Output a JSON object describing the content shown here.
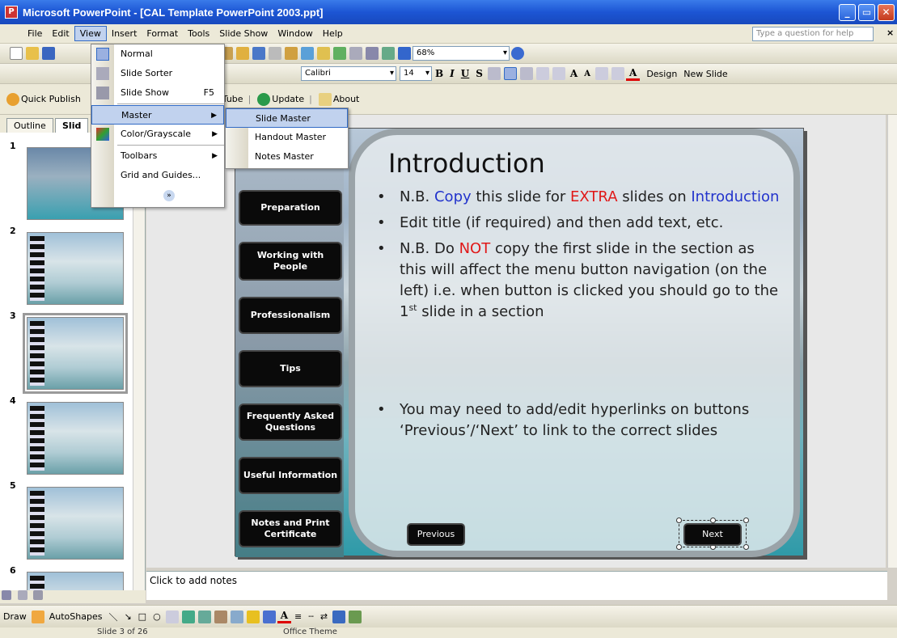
{
  "window": {
    "title": "Microsoft PowerPoint - [CAL Template PowerPoint 2003.ppt]"
  },
  "menubar": {
    "items": [
      "File",
      "Edit",
      "View",
      "Insert",
      "Format",
      "Tools",
      "Slide Show",
      "Window",
      "Help"
    ],
    "help_placeholder": "Type a question for help"
  },
  "toolbar": {
    "zoom": "68%",
    "font": "Calibri",
    "font_size": "14",
    "design": "Design",
    "new_slide": "New Slide",
    "quick_publish": "Quick Publish",
    "youtube": "uTube",
    "update": "Update",
    "about": "About"
  },
  "tabs": {
    "outline": "Outline",
    "slides": "Slid"
  },
  "thumbnails": [
    "1",
    "2",
    "3",
    "4",
    "5",
    "6"
  ],
  "view_menu": {
    "items": [
      {
        "label": "Normal",
        "shortcut": ""
      },
      {
        "label": "Slide Sorter",
        "shortcut": ""
      },
      {
        "label": "Slide Show",
        "shortcut": "F5"
      },
      {
        "label": "Master",
        "shortcut": ""
      },
      {
        "label": "Color/Grayscale",
        "shortcut": ""
      },
      {
        "label": "Toolbars",
        "shortcut": ""
      },
      {
        "label": "Grid and Guides...",
        "shortcut": ""
      }
    ]
  },
  "master_menu": {
    "items": [
      "Slide Master",
      "Handout Master",
      "Notes Master"
    ]
  },
  "slide": {
    "title": "Introduction",
    "nav_buttons": [
      "Preparation",
      "Working with People",
      "Professionalism",
      "Tips",
      "Frequently Asked Questions",
      "Useful Information",
      "Notes and Print Certificate"
    ],
    "bullet1_a": "N.B. ",
    "bullet1_b": "Copy",
    "bullet1_c": " this slide for ",
    "bullet1_d": "EXTRA",
    "bullet1_e": " slides on ",
    "bullet1_f": "Introduction",
    "bullet2": "Edit title (if required) and then add text, etc.",
    "bullet3_a": "N.B. Do ",
    "bullet3_b": "NOT",
    "bullet3_c": " copy the first slide in the section as this will affect the menu button navigation (on the left) i.e. when button is clicked you should go to the 1",
    "bullet3_sup": "st",
    "bullet3_d": " slide in a section",
    "bullet4": "You may need to add/edit hyperlinks on buttons ‘Previous’/‘Next’ to link to the correct slides",
    "previous": "Previous",
    "next": "Next"
  },
  "notes": {
    "placeholder": "Click to add notes"
  },
  "drawbar": {
    "draw": "Draw",
    "autoshapes": "AutoShapes"
  },
  "status": {
    "slide": "Slide 3 of 26",
    "theme": "Office Theme"
  }
}
